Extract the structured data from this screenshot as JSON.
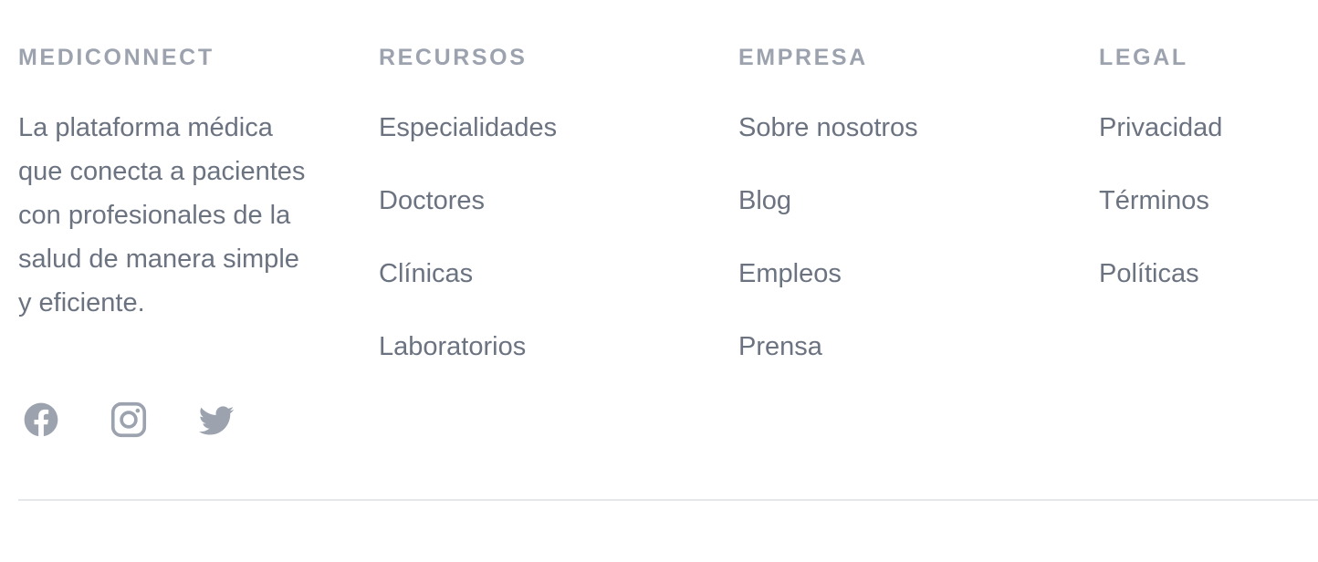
{
  "brand": {
    "heading": "MEDICONNECT",
    "description": "La plataforma médica que conecta a pacientes con profesionales de la salud de manera simple y eficiente.",
    "social": [
      {
        "icon": "facebook-icon",
        "label": "Facebook"
      },
      {
        "icon": "instagram-icon",
        "label": "Instagram"
      },
      {
        "icon": "twitter-icon",
        "label": "Twitter"
      }
    ]
  },
  "recursos": {
    "heading": "RECURSOS",
    "links": [
      "Especialidades",
      "Doctores",
      "Clínicas",
      "Laboratorios"
    ]
  },
  "empresa": {
    "heading": "EMPRESA",
    "links": [
      "Sobre nosotros",
      "Blog",
      "Empleos",
      "Prensa"
    ]
  },
  "legal": {
    "heading": "LEGAL",
    "links": [
      "Privacidad",
      "Términos",
      "Políticas"
    ]
  },
  "colors": {
    "heading": "#9ca3af",
    "text": "#6b7280",
    "icon": "#9ca3af",
    "divider": "#e5e7eb",
    "background": "#ffffff"
  }
}
